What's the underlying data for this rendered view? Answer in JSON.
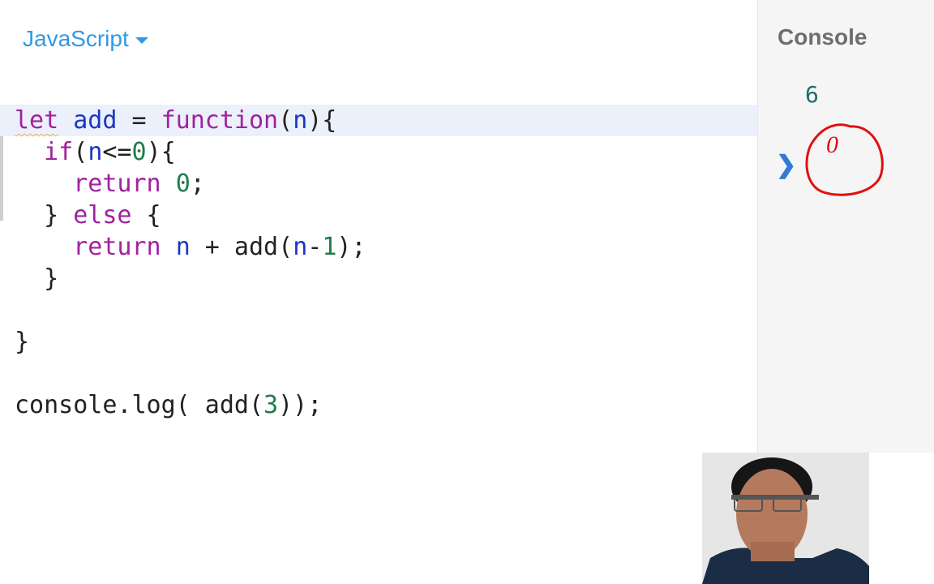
{
  "editor": {
    "language": "JavaScript",
    "lines": [
      [
        {
          "t": "let",
          "c": "kw squiggle"
        },
        {
          "t": " "
        },
        {
          "t": "add",
          "c": "var"
        },
        {
          "t": " = "
        },
        {
          "t": "function",
          "c": "kw"
        },
        {
          "t": "("
        },
        {
          "t": "n",
          "c": "var"
        },
        {
          "t": "){"
        }
      ],
      [
        {
          "t": "  "
        },
        {
          "t": "if",
          "c": "kw"
        },
        {
          "t": "("
        },
        {
          "t": "n",
          "c": "var"
        },
        {
          "t": "<="
        },
        {
          "t": "0",
          "c": "num"
        },
        {
          "t": "){"
        }
      ],
      [
        {
          "t": "    "
        },
        {
          "t": "return",
          "c": "kw"
        },
        {
          "t": " "
        },
        {
          "t": "0",
          "c": "num"
        },
        {
          "t": ";"
        }
      ],
      [
        {
          "t": "  } "
        },
        {
          "t": "else",
          "c": "kw"
        },
        {
          "t": " {"
        }
      ],
      [
        {
          "t": "    "
        },
        {
          "t": "return",
          "c": "kw"
        },
        {
          "t": " "
        },
        {
          "t": "n",
          "c": "var"
        },
        {
          "t": " + add("
        },
        {
          "t": "n",
          "c": "var"
        },
        {
          "t": "-"
        },
        {
          "t": "1",
          "c": "num"
        },
        {
          "t": ");"
        }
      ],
      [
        {
          "t": "  }"
        }
      ],
      [],
      [
        {
          "t": "}"
        }
      ],
      [],
      [
        {
          "t": "console.log( add("
        },
        {
          "t": "3",
          "c": "num"
        },
        {
          "t": "));"
        }
      ]
    ],
    "active_line": 0
  },
  "console": {
    "title": "Console",
    "output": "6",
    "prompt_symbol": "❯",
    "input_value": "0"
  },
  "colors": {
    "accent": "#2f9ae6",
    "keyword": "#a0229f",
    "variable": "#1a38c2",
    "number": "#1f7d4a",
    "annotation": "#e01010"
  }
}
